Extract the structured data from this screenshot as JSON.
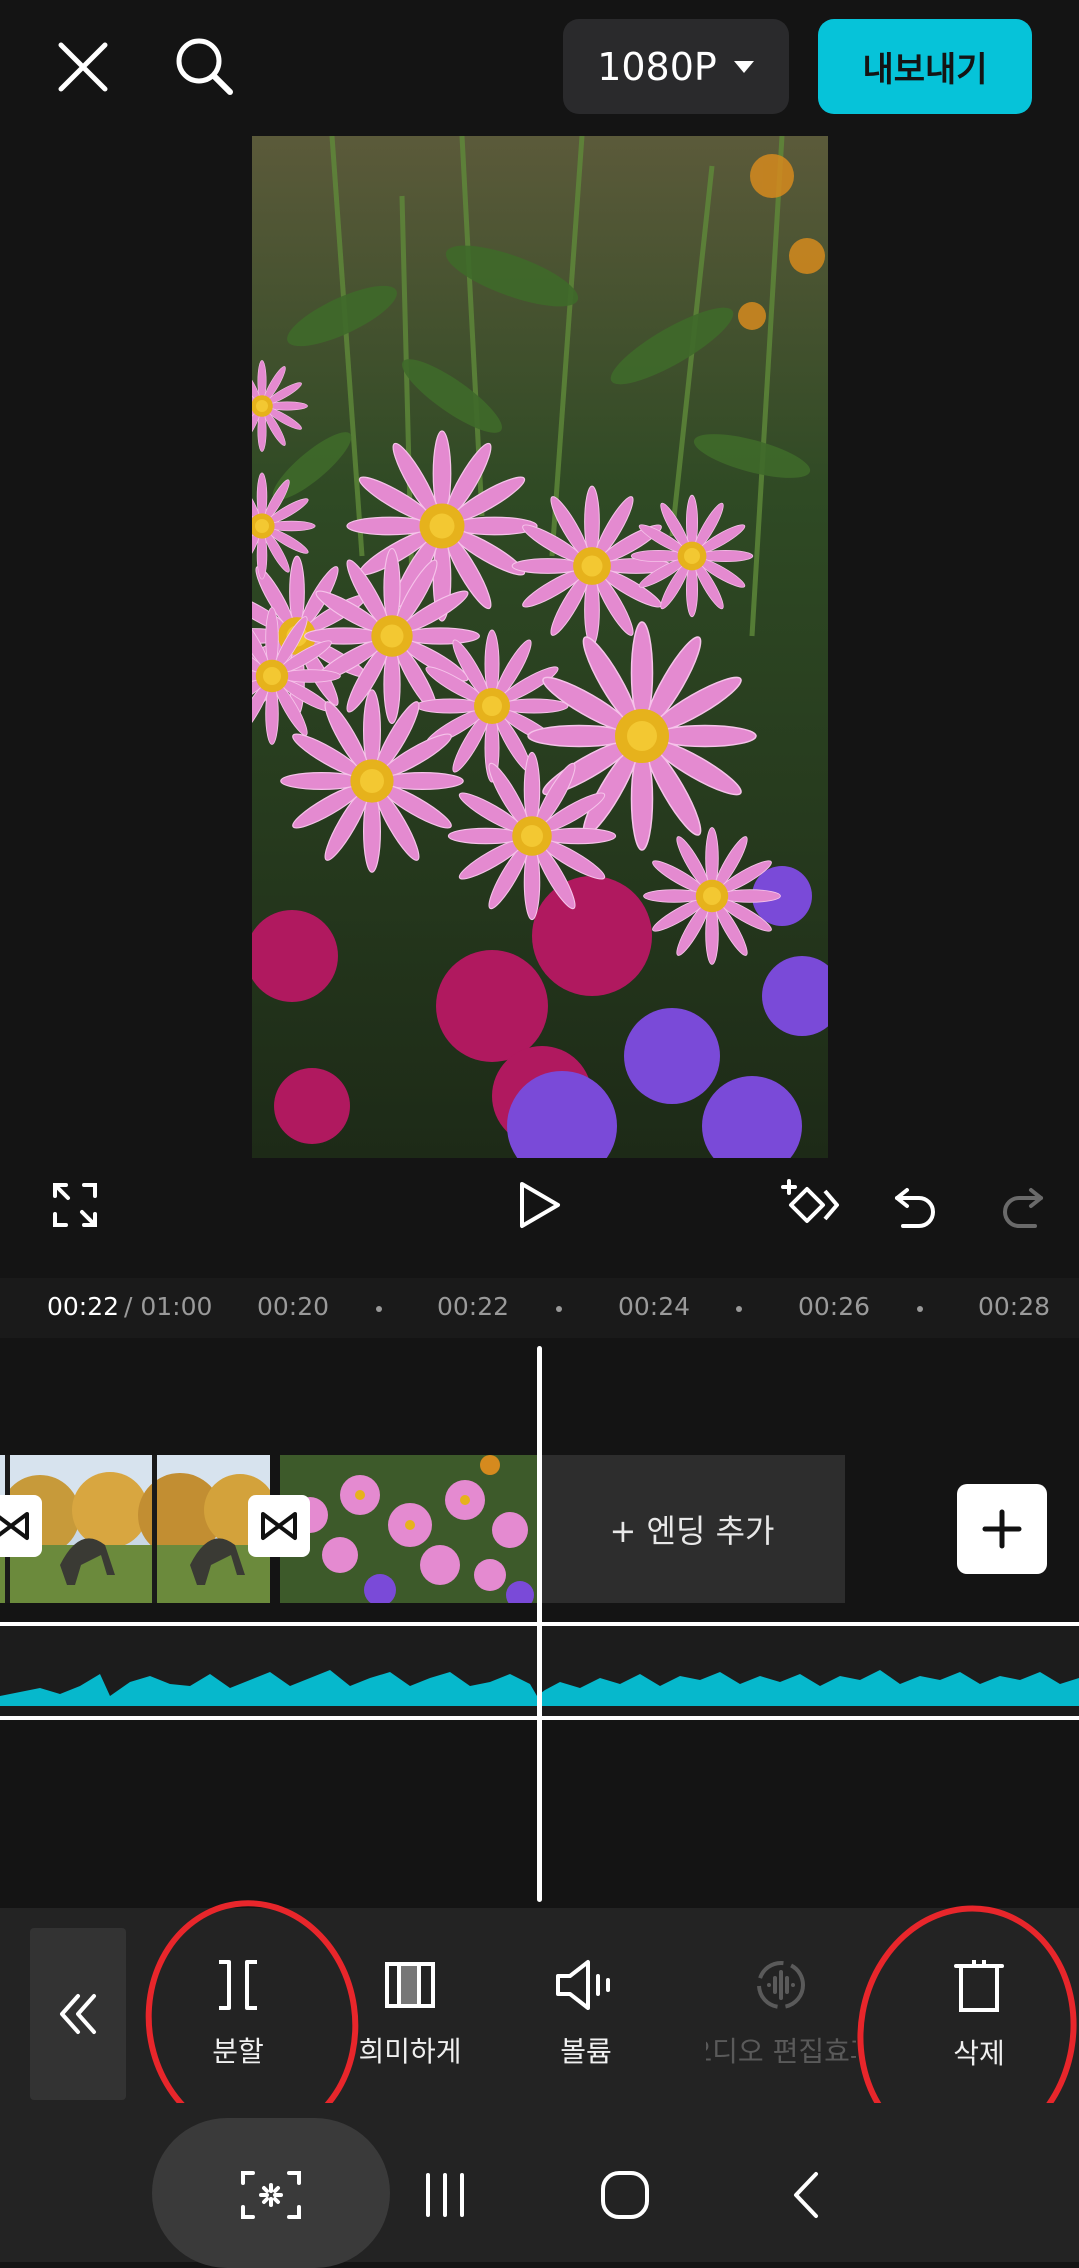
{
  "header": {
    "resolution": "1080P",
    "export_label": "내보내기"
  },
  "timeline": {
    "current_time": "00:22",
    "total_time": "/ 01:00",
    "ticks": [
      "00:20",
      "00:22",
      "00:24",
      "00:26",
      "00:28"
    ],
    "ending_label": "+ 엔딩 추가"
  },
  "toolbar": {
    "items": [
      {
        "label": "분할",
        "icon": "split-icon",
        "enabled": true
      },
      {
        "label": "희미하게",
        "icon": "fade-icon",
        "enabled": true
      },
      {
        "label": "볼륨",
        "icon": "volume-icon",
        "enabled": true
      },
      {
        "label": "오디오 편집효과",
        "icon": "audio-effect-icon",
        "enabled": false
      },
      {
        "label": "삭제",
        "icon": "delete-icon",
        "enabled": true
      }
    ]
  },
  "colors": {
    "accent": "#06c3d9",
    "background": "#141414",
    "annotation": "#e8262b"
  }
}
